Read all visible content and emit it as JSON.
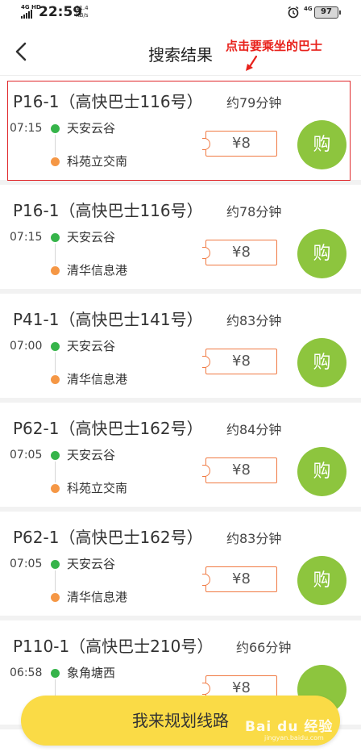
{
  "status_bar": {
    "network_top": "4G HD",
    "time": "22:59",
    "speed_value": "11.4",
    "speed_unit": "KB/s",
    "network_right": "4G",
    "battery": "97"
  },
  "header": {
    "title": "搜索结果",
    "back_icon": "chevron-left-icon",
    "annotation": "点击要乘坐的巴士"
  },
  "results": [
    {
      "route": "P16-1（高快巴士116号）",
      "duration": "约79分钟",
      "time": "07:15",
      "from": "天安云谷",
      "to": "科苑立交南",
      "price": "¥8",
      "buy": "购"
    },
    {
      "route": "P16-1（高快巴士116号）",
      "duration": "约78分钟",
      "time": "07:15",
      "from": "天安云谷",
      "to": "清华信息港",
      "price": "¥8",
      "buy": "购"
    },
    {
      "route": "P41-1（高快巴士141号）",
      "duration": "约83分钟",
      "time": "07:00",
      "from": "天安云谷",
      "to": "清华信息港",
      "price": "¥8",
      "buy": "购"
    },
    {
      "route": "P62-1（高快巴士162号）",
      "duration": "约84分钟",
      "time": "07:05",
      "from": "天安云谷",
      "to": "科苑立交南",
      "price": "¥8",
      "buy": "购"
    },
    {
      "route": "P62-1（高快巴士162号）",
      "duration": "约83分钟",
      "time": "07:05",
      "from": "天安云谷",
      "to": "清华信息港",
      "price": "¥8",
      "buy": "购"
    },
    {
      "route": "P110-1（高快巴士210号）",
      "duration": "约66分钟",
      "time": "06:58",
      "from": "象角塘西",
      "to": "",
      "price": "¥8",
      "buy": ""
    }
  ],
  "plan_button": "我来规划线路",
  "watermark": {
    "text": "Bai du 经验",
    "url": "jingyan.baidu.com"
  },
  "colors": {
    "accent_yellow": "#fadb46",
    "buy_green": "#8dc53e",
    "ticket_orange": "#f07a43",
    "highlight_red": "#e0272b"
  }
}
